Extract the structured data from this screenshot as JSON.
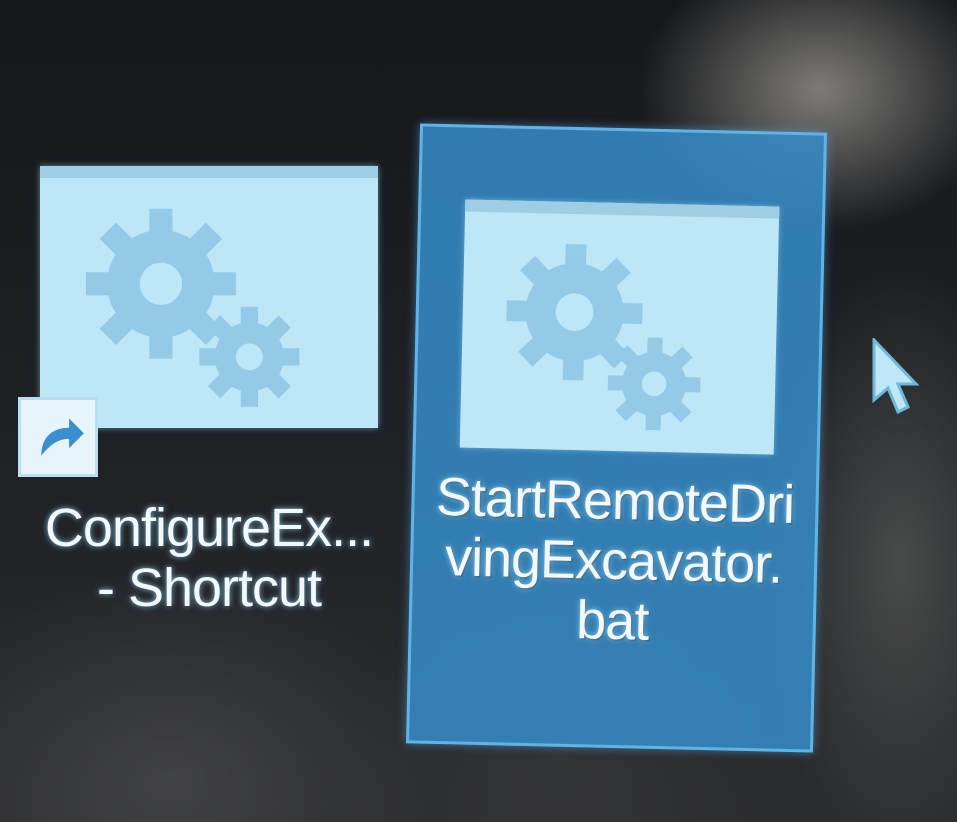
{
  "desktop": {
    "icons": [
      {
        "label_line1": "ConfigureEx...",
        "label_line2": "- Shortcut",
        "icon": "gear-cog-file-icon",
        "shortcut_overlay": "shortcut-arrow-icon",
        "selected": false
      },
      {
        "label": "StartRemoteDrivingExcavator.bat",
        "icon": "gear-cog-file-icon",
        "selected": true
      }
    ],
    "cursor": "mouse-pointer-icon"
  },
  "colors": {
    "selection": "#358cc8",
    "icon_face": "#bde6f6",
    "gear": "#8ec6e6"
  }
}
